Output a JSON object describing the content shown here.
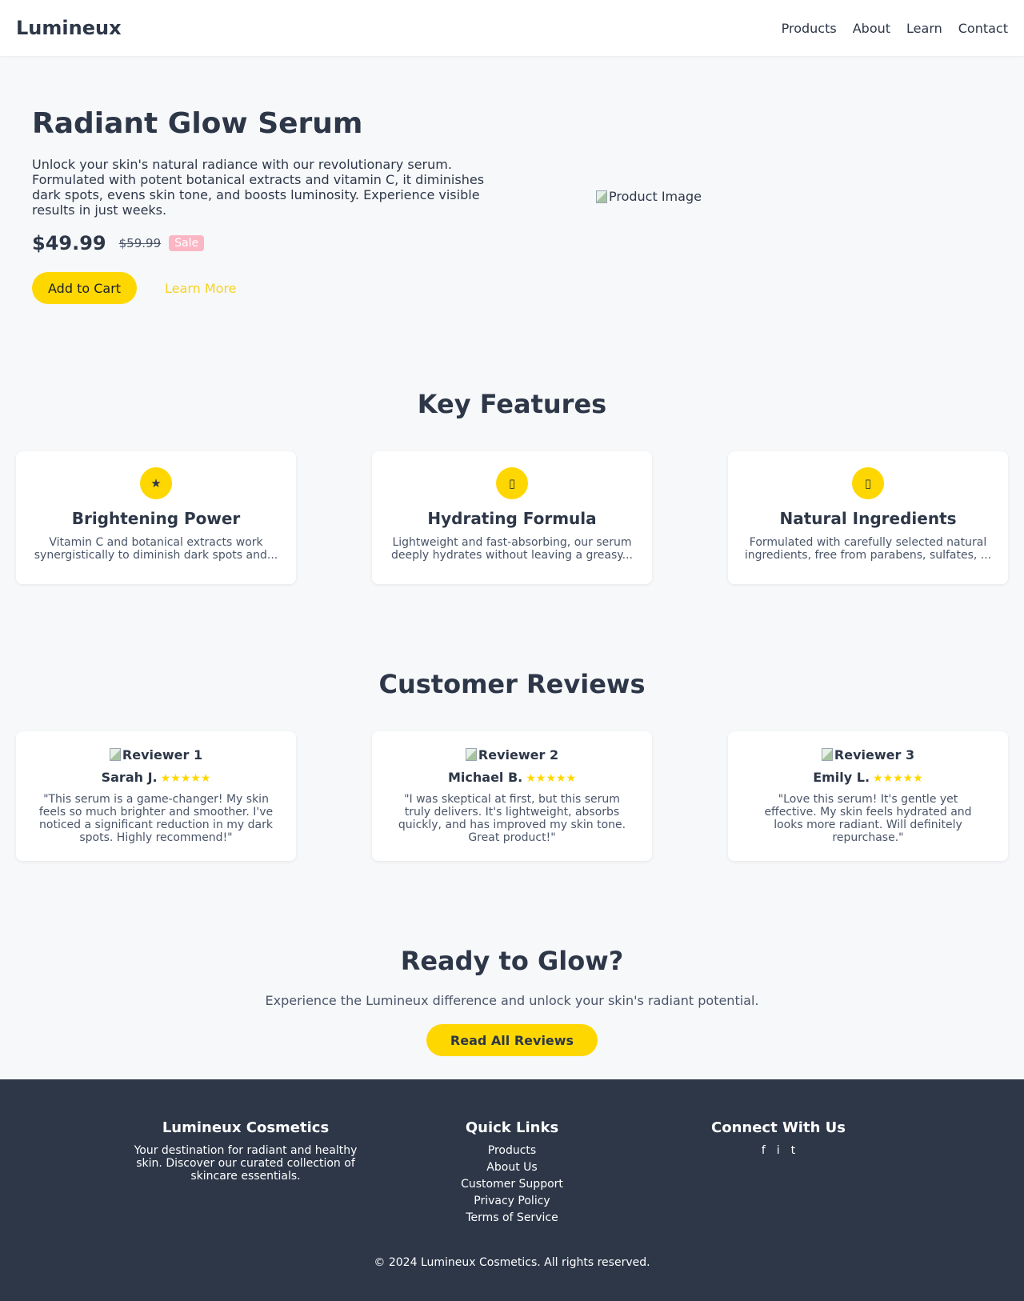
{
  "header": {
    "brand": "Lumineux",
    "nav": [
      "Products",
      "About",
      "Learn",
      "Contact"
    ]
  },
  "hero": {
    "title": "Radiant Glow Serum",
    "description": "Unlock your skin's natural radiance with our revolutionary serum. Formulated with potent botanical extracts and vitamin C, it diminishes dark spots, evens skin tone, and boosts luminosity. Experience visible results in just weeks.",
    "price": "$49.99",
    "old_price": "$59.99",
    "sale_badge": "Sale",
    "add_to_cart": "Add to Cart",
    "learn_more": "Learn More",
    "image_alt": "Product Image"
  },
  "features": {
    "title": "Key Features",
    "items": [
      {
        "icon": "star-icon",
        "glyph": "★",
        "title": "Brightening Power",
        "text": "Vitamin C and botanical extracts work synergistically to diminish dark spots and..."
      },
      {
        "icon": "droplet-icon",
        "glyph": "▯",
        "title": "Hydrating Formula",
        "text": "Lightweight and fast-absorbing, our serum deeply hydrates without leaving a greasy..."
      },
      {
        "icon": "leaf-icon",
        "glyph": "▯",
        "title": "Natural Ingredients",
        "text": "Formulated with carefully selected natural ingredients, free from parabens, sulfates, ..."
      }
    ]
  },
  "reviews": {
    "title": "Customer Reviews",
    "items": [
      {
        "image_alt": "Reviewer 1",
        "name": "Sarah J.",
        "stars": "★★★★★",
        "rating": 5,
        "text": "\"This serum is a game-changer! My skin feels so much brighter and smoother. I've noticed a significant reduction in my dark spots. Highly recommend!\""
      },
      {
        "image_alt": "Reviewer 2",
        "name": "Michael B.",
        "stars": "★★★★★",
        "rating": 5,
        "text": "\"I was skeptical at first, but this serum truly delivers. It's lightweight, absorbs quickly, and has improved my skin tone. Great product!\""
      },
      {
        "image_alt": "Reviewer 3",
        "name": "Emily L.",
        "stars": "★★★★★",
        "rating": 5,
        "text": "\"Love this serum! It's gentle yet effective. My skin feels hydrated and looks more radiant. Will definitely repurchase.\""
      }
    ]
  },
  "cta": {
    "title": "Ready to Glow?",
    "text": "Experience the Lumineux difference and unlock your skin's radiant potential.",
    "button": "Read All Reviews"
  },
  "footer": {
    "about_title": "Lumineux Cosmetics",
    "about_text": "Your destination for radiant and healthy skin. Discover our curated collection of skincare essentials.",
    "links_title": "Quick Links",
    "links": [
      "Products",
      "About Us",
      "Customer Support",
      "Privacy Policy",
      "Terms of Service"
    ],
    "connect_title": "Connect With Us",
    "social": [
      {
        "icon": "facebook-icon",
        "glyph": "f"
      },
      {
        "icon": "instagram-icon",
        "glyph": "i"
      },
      {
        "icon": "twitter-icon",
        "glyph": "t"
      }
    ],
    "copyright": "© 2024 Lumineux Cosmetics. All rights reserved."
  },
  "colors": {
    "accent": "#ffd700",
    "text": "#2d3748",
    "background": "#f7f8fa",
    "footer": "#2d3748",
    "sale_badge": "#fbb6c4"
  }
}
